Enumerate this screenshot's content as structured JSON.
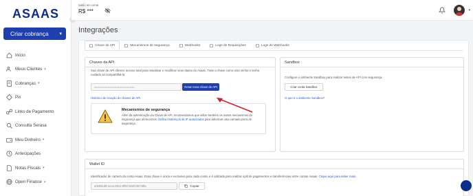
{
  "app": {
    "logo_text": "ASAAS"
  },
  "sidebar": {
    "cta_label": "Criar cobrança",
    "items": [
      {
        "label": "Início",
        "icon": "home-icon",
        "has_caret": false
      },
      {
        "label": "Meus Clientes",
        "icon": "users-icon",
        "has_caret": true
      },
      {
        "label": "Cobranças",
        "icon": "invoice-icon",
        "has_caret": true
      },
      {
        "label": "Pix",
        "icon": "pix-icon",
        "has_caret": false
      },
      {
        "label": "Links de Pagamento",
        "icon": "link-icon",
        "has_caret": false
      },
      {
        "label": "Consulta Serasa",
        "icon": "search-doc-icon",
        "has_caret": false
      },
      {
        "label": "Meu Dinheiro",
        "icon": "wallet-icon",
        "has_caret": true
      },
      {
        "label": "Antecipações",
        "icon": "clock-icon",
        "has_caret": false
      },
      {
        "label": "Notas Fiscais",
        "icon": "document-icon",
        "has_caret": true
      },
      {
        "label": "Open Finance",
        "icon": "globe-icon",
        "has_caret": true
      }
    ]
  },
  "topbar": {
    "balance_label": "Saldo em conta",
    "balance_value": "R$ ***"
  },
  "page": {
    "title": "Integrações"
  },
  "tabs": [
    {
      "label": "Chave de API",
      "active": true
    },
    {
      "label": "Mecanismos de segurança",
      "active": false
    },
    {
      "label": "Webhooks",
      "active": false
    },
    {
      "label": "Logs de Requisições",
      "active": false
    },
    {
      "label": "Logs de Webhooks",
      "active": false
    }
  ],
  "api_keys": {
    "heading": "Chaves da API",
    "description": "Sua chave de API oferece acesso total para visualizar e modificar seus dados do Asaas. Trate a chave como uma senha e tenha cuidado ao compartilhá-la.",
    "key_placeholder": "••••••••••••••••••••••••••••••••••••••••••",
    "generate_button": "Gerar nova chave de API",
    "history_link": "Histórico de criação de chaves de API",
    "security_title": "Mecanismos de segurança",
    "security_text": "Além da autenticação via Chave de API, recomendamos que utilize também os outros mecanismos de segurança que oferecemos.",
    "security_link": "Defina endereços de IP autorizados",
    "security_text_end": "para adicionar uma camada extra de segurança."
  },
  "sandbox": {
    "heading": "Sandbox",
    "description": "Configure o ambiente Sandbox para realizar testes de API com segurança.",
    "button": "Criar conta Sandbox",
    "link": "O que é o ambiente Sandbox?"
  },
  "wallet": {
    "heading": "Wallet ID",
    "description": "Identificador de carteira da conta Asaas. Essa chave é única e exclusiva para cada conta, e é utilizada para realizar split de pagamentos e transferências entre contas Asaas.",
    "link": "Clique aqui para saber mais.",
    "value": "a0e88cd9-1eca-4811-8f00-92efc05748fa",
    "copy_button": "Copiar"
  },
  "colors": {
    "brand": "#1f3fae",
    "link": "#1f5fd6",
    "arrow": "#d02030"
  }
}
